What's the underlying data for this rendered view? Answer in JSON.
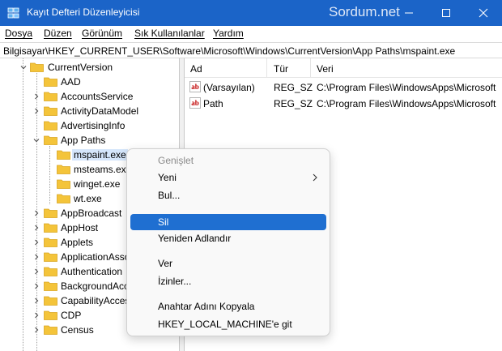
{
  "window": {
    "title": "Kayıt Defteri Düzenleyicisi",
    "watermark": "Sordum.net"
  },
  "menu": [
    {
      "label": "Dosya"
    },
    {
      "label": "Düzen"
    },
    {
      "label": "Görünüm"
    },
    {
      "label": "Sık Kullanılanlar"
    },
    {
      "label": "Yardım"
    }
  ],
  "address": {
    "path": "Bilgisayar\\HKEY_CURRENT_USER\\Software\\Microsoft\\Windows\\CurrentVersion\\App Paths\\mspaint.exe"
  },
  "tree": {
    "items": [
      {
        "label": "CurrentVersion",
        "state": "expanded"
      },
      {
        "label": "AAD",
        "state": "leaf"
      },
      {
        "label": "AccountsService",
        "state": "collapsed"
      },
      {
        "label": "ActivityDataModel",
        "state": "collapsed"
      },
      {
        "label": "AdvertisingInfo",
        "state": "leaf"
      },
      {
        "label": "App Paths",
        "state": "expanded"
      },
      {
        "label": "mspaint.exe",
        "state": "selected"
      },
      {
        "label": "msteams.exe",
        "state": "leaf"
      },
      {
        "label": "winget.exe",
        "state": "leaf"
      },
      {
        "label": "wt.exe",
        "state": "leaf"
      },
      {
        "label": "AppBroadcast",
        "state": "collapsed"
      },
      {
        "label": "AppHost",
        "state": "collapsed"
      },
      {
        "label": "Applets",
        "state": "collapsed"
      },
      {
        "label": "ApplicationAsso",
        "state": "collapsed"
      },
      {
        "label": "Authentication",
        "state": "collapsed"
      },
      {
        "label": "BackgroundAcce",
        "state": "collapsed"
      },
      {
        "label": "CapabilityAcces",
        "state": "collapsed"
      },
      {
        "label": "CDP",
        "state": "collapsed"
      },
      {
        "label": "Census",
        "state": "collapsed"
      }
    ]
  },
  "list": {
    "columns": [
      "Ad",
      "Tür",
      "Veri"
    ],
    "rows": [
      {
        "name": "(Varsayılan)",
        "type": "REG_SZ",
        "data": "C:\\Program Files\\WindowsApps\\Microsoft"
      },
      {
        "name": "Path",
        "type": "REG_SZ",
        "data": "C:\\Program Files\\WindowsApps\\Microsoft"
      }
    ]
  },
  "context_menu": {
    "items": [
      {
        "label": "Genişlet",
        "disabled": true
      },
      {
        "label": "Yeni",
        "submenu": true
      },
      {
        "label": "Bul..."
      },
      {
        "label": "Sil",
        "highlighted": true
      },
      {
        "label": "Yeniden Adlandır"
      },
      {
        "label": "Ver"
      },
      {
        "label": "İzinler..."
      },
      {
        "label": "Anahtar Adını Kopyala"
      },
      {
        "label": "HKEY_LOCAL_MACHINE'e git"
      }
    ]
  },
  "colors": {
    "titlebar": "#1b64c8",
    "folder": "#f4c43a",
    "highlight": "#1f6fd1",
    "selection": "#d5e6fb"
  },
  "icons": {
    "app": "registry-editor-icon",
    "folder": "folder-icon",
    "string_value": "string-value-icon"
  }
}
